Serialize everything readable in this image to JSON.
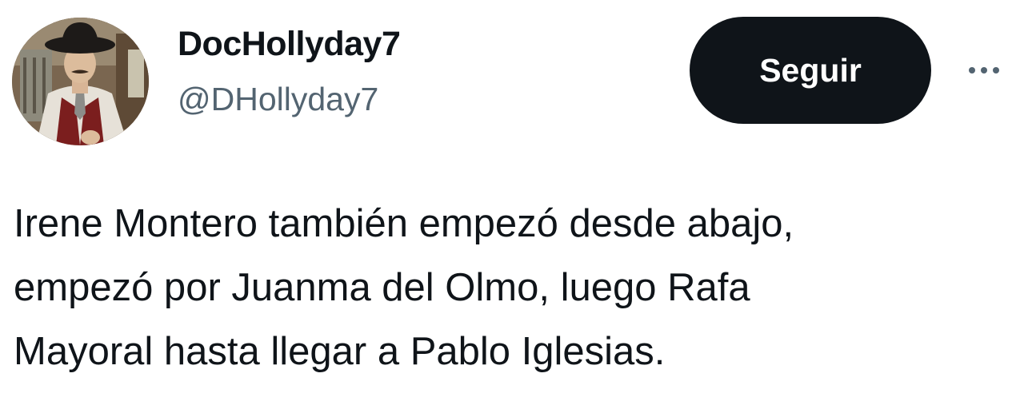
{
  "author": {
    "display_name": "DocHollyday7",
    "handle": "@DHollyday7",
    "avatar_icon": "profile-photo"
  },
  "actions": {
    "follow_label": "Seguir",
    "more_icon": "more-options-icon"
  },
  "tweet": {
    "lines": [
      "Irene Montero también empezó desde abajo,",
      "empezó por Juanma del Olmo, luego Rafa",
      "Mayoral hasta llegar a Pablo Iglesias."
    ]
  },
  "colors": {
    "text_primary": "#0f1419",
    "text_secondary": "#536471",
    "button_bg": "#0f1419",
    "button_text": "#ffffff",
    "background": "#ffffff"
  }
}
